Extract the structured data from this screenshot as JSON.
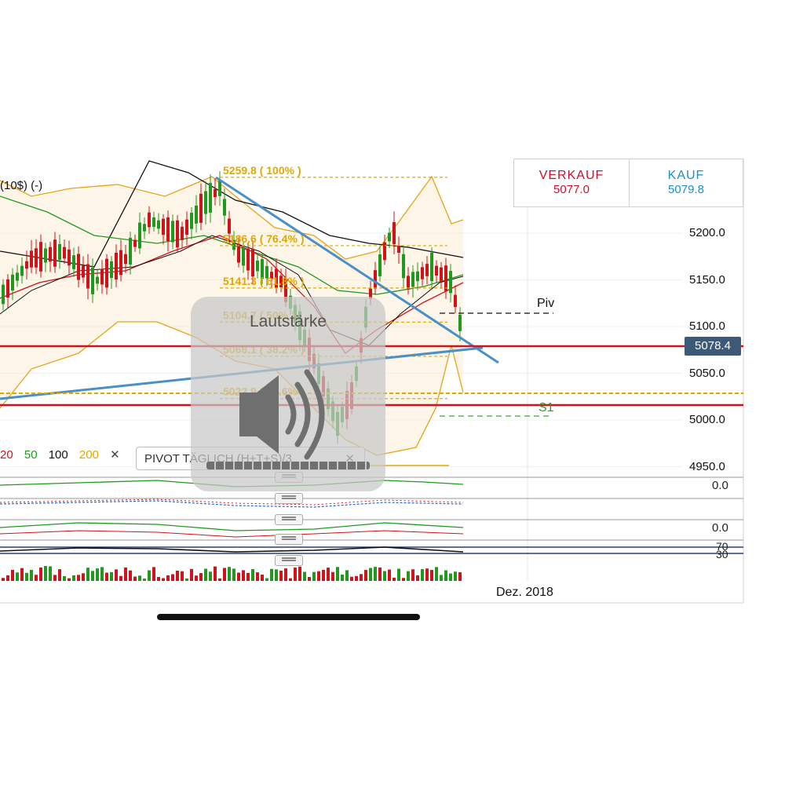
{
  "toolbar": {
    "title_fragment": "(10$) (-)"
  },
  "quote": {
    "sell_label": "VERKAUF",
    "sell_value": "5077.0",
    "buy_label": "KAUF",
    "buy_value": "5079.8"
  },
  "price_axis": {
    "ticks": [
      "5200.0",
      "5150.0",
      "5100.0",
      "5050.0",
      "5000.0",
      "4950.0"
    ],
    "current": "5078.4"
  },
  "fib_levels": [
    {
      "label": "5259.8 ( 100% )",
      "value": 5259.8
    },
    {
      "label": "5186.6 ( 76.4% )",
      "value": 5186.6
    },
    {
      "label": "5141.3 ( 61.8% )",
      "value": 5141.3
    },
    {
      "label": "5104.7 ( 50% )",
      "value": 5104.7
    },
    {
      "label": "5068.1 ( 38.2% )",
      "value": 5068.1
    },
    {
      "label": "5022.9 ( 23.6% )",
      "value": 5022.9
    }
  ],
  "pivot_labels": {
    "piv": "Piv",
    "s1": "S1"
  },
  "legend": {
    "items": [
      {
        "label": "20",
        "color": "#d0121b"
      },
      {
        "label": "50",
        "color": "#1f9a1f"
      },
      {
        "label": "100",
        "color": "#111111"
      },
      {
        "label": "200",
        "color": "#e0a800"
      }
    ],
    "close": "✕"
  },
  "pivot_chip": {
    "label": "PIVOT TÄGLICH (H+T+S)/3",
    "close": "✕"
  },
  "indicators": {
    "zero_1": "0.0",
    "zero_2": "0.0",
    "rsi_70": "70",
    "rsi_30": "30"
  },
  "time_axis": {
    "label": "Dez. 2018"
  },
  "volume_hud": {
    "title": "Lautstärke",
    "icon": "speaker-icon"
  },
  "colors": {
    "up": "#1f9a1f",
    "down": "#d0121b",
    "trend": "#4a90c8",
    "fib": "#e0a800",
    "band": "#e8a317"
  }
}
